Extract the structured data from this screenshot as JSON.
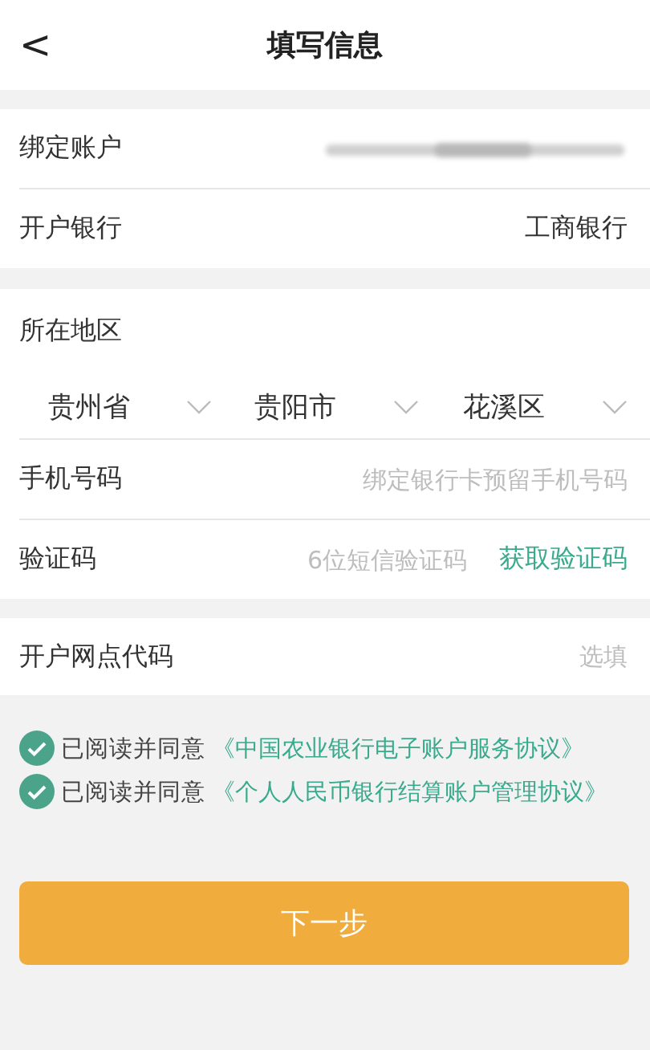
{
  "header": {
    "back": "<",
    "title": "填写信息"
  },
  "account": [
    {
      "label": "绑定账户",
      "kind": "masked"
    },
    {
      "label": "开户银行",
      "kind": "text",
      "value": "工商银行"
    }
  ],
  "region": {
    "label": "所在地区",
    "selects": [
      {
        "value": "贵州省"
      },
      {
        "value": "贵阳市"
      },
      {
        "value": "花溪区"
      }
    ]
  },
  "phone": {
    "label": "手机号码",
    "placeholder": "绑定银行卡预留手机号码"
  },
  "code": {
    "label": "验证码",
    "placeholder": "6位短信验证码",
    "action": "获取验证码"
  },
  "branch": {
    "label": "开户网点代码",
    "placeholder": "选填"
  },
  "agreements": [
    {
      "prefix": "已阅读并同意",
      "link": "《中国农业银行电子账户服务协议》",
      "checked": true
    },
    {
      "prefix": "已阅读并同意",
      "link": "《个人人民币银行结算账户管理协议》",
      "checked": true
    }
  ],
  "next_button": "下一步"
}
